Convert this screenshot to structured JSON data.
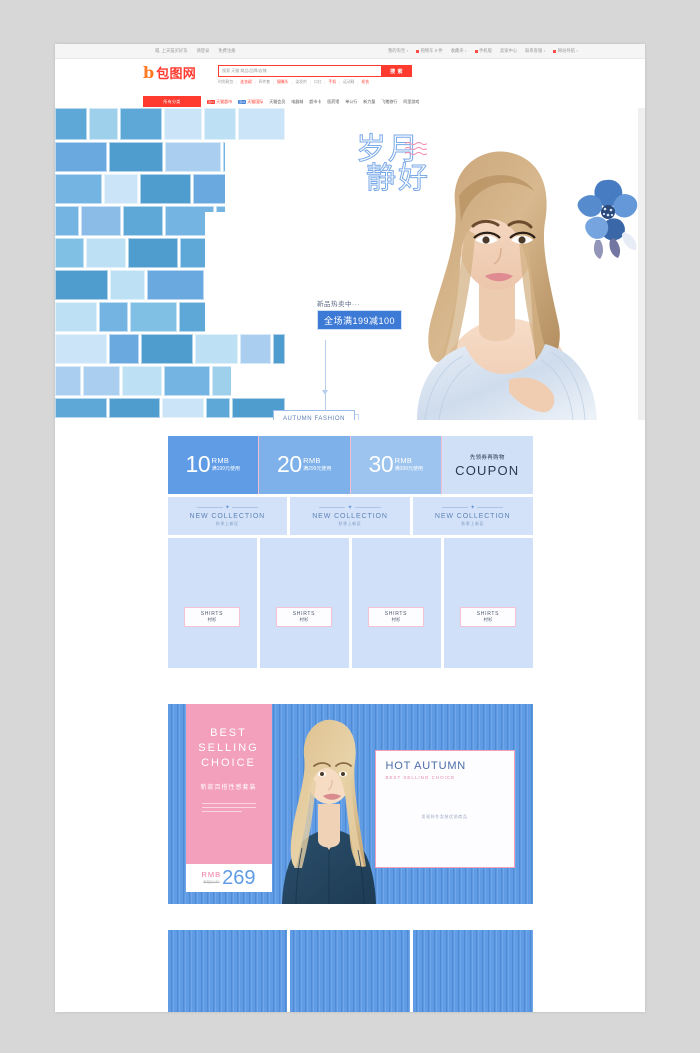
{
  "topbar": {
    "left": [
      "喵, 上天猫买好货",
      "请登录",
      "免费注册"
    ],
    "right": [
      "我的淘宝",
      "购物车 0 件",
      "收藏夹",
      "手机版",
      "卖家中心",
      "联系客服",
      "网站导航"
    ]
  },
  "brand": {
    "logo_mark": "b",
    "logo_text": "包图网"
  },
  "search": {
    "placeholder": "搜索 天猫 商品/品牌/店铺",
    "button_label": "搜 索",
    "hotwords": [
      "时尚鞋包",
      "连衣裙",
      "四件套",
      "摄像头",
      "染发剂",
      "口红",
      "手机",
      "运动鞋",
      "毛衣"
    ]
  },
  "nav": {
    "category_label": "所有分类",
    "items": [
      "天猫超市",
      "天猫国际",
      "天猫会员",
      "电器城",
      "超市卡",
      "医药馆",
      "单公行",
      "新力量",
      "飞猪旅行",
      "阿里游戏"
    ],
    "badges": [
      "双11",
      "双11"
    ]
  },
  "hero": {
    "headline_line1": "岁月",
    "headline_line2": "静好",
    "promo_top": "新品热卖中···",
    "promo_bar": "全场满199减100",
    "autumn_button": "AUTUMN FASHION",
    "wave_color": "#f08fb0",
    "headline_color": "#7aa9e8",
    "promo_bar_color": "#3d7ad6"
  },
  "coupons": [
    {
      "amount": "10",
      "unit": "RMB",
      "condition": "满199元使用",
      "bg": "#5f9ce5"
    },
    {
      "amount": "20",
      "unit": "RMB",
      "condition": "满299元使用",
      "bg": "#7eb1e9"
    },
    {
      "amount": "30",
      "unit": "RMB",
      "condition": "满399元使用",
      "bg": "#9cc4ee"
    }
  ],
  "coupon_cta": {
    "top": "先领券再购物",
    "word": "COUPON",
    "bg": "#cfe0f7"
  },
  "new_collection": [
    {
      "title": "NEW COLLECTION",
      "sub": "秋季上新区"
    },
    {
      "title": "NEW COLLECTION",
      "sub": "秋季上新区"
    },
    {
      "title": "NEW COLLECTION",
      "sub": "秋季上新区"
    }
  ],
  "shirts": [
    {
      "en": "SHIRTS",
      "cn": "衬衫"
    },
    {
      "en": "SHIRTS",
      "cn": "衬衫"
    },
    {
      "en": "SHIRTS",
      "cn": "衬衫"
    },
    {
      "en": "SHIRTS",
      "cn": "衬衫"
    }
  ],
  "best_selling": {
    "line1": "BEST",
    "line2": "SELLING",
    "line3": "CHOICE",
    "subtitle_cn": "新款百搭性感套装",
    "price_currency": "RMB",
    "price_old": "专柜价489",
    "price_value": "269",
    "panel_color": "#f3a0bd"
  },
  "hot_autumn": {
    "title": "HOT AUTUMN",
    "subtitle": "BEST SELLING CHOICE",
    "note_cn": "发现秋冬女装优质商品",
    "border_color": "#f3a0bd"
  },
  "bottom_tiles": [
    {
      "name": "tile-1"
    },
    {
      "name": "tile-2"
    },
    {
      "name": "tile-3"
    }
  ]
}
